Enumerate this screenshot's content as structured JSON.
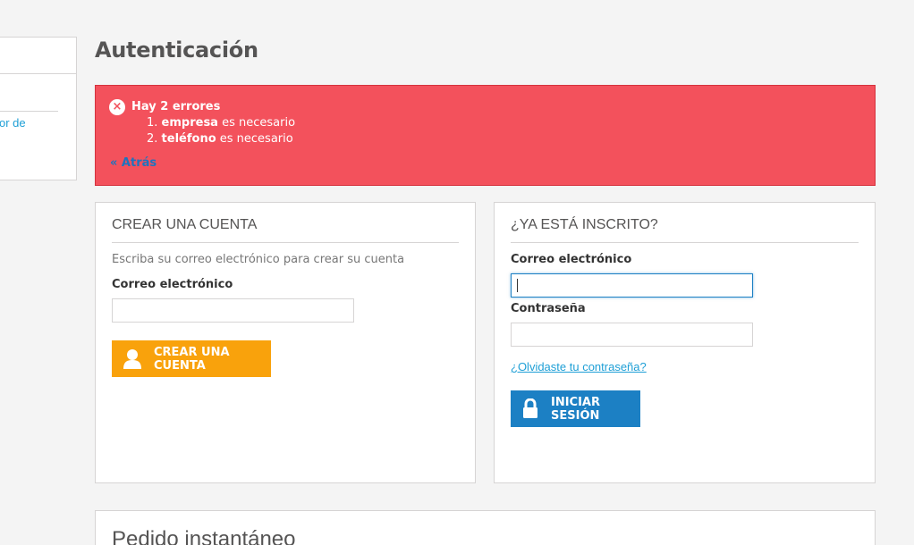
{
  "sidebar": {
    "link_fragment": "or de"
  },
  "page": {
    "title": "Autenticación"
  },
  "alert": {
    "title": "Hay 2 errores",
    "errors": [
      {
        "num": "1.",
        "field": "empresa",
        "msg": "es necesario"
      },
      {
        "num": "2.",
        "field": "teléfono",
        "msg": "es necesario"
      }
    ],
    "back_link": "« Atrás"
  },
  "create_account": {
    "heading": "CREAR UNA CUENTA",
    "hint": "Escriba su correo electrónico para crear su cuenta",
    "email_label": "Correo electrónico",
    "email_value": "",
    "button_label": "CREAR UNA CUENTA",
    "button_icon": "user-icon",
    "button_color": "#f9a20c"
  },
  "login": {
    "heading": "¿YA ESTÁ INSCRITO?",
    "email_label": "Correo electrónico",
    "email_value": "",
    "password_label": "Contraseña",
    "password_value": "",
    "forgot_link": "¿Olvidaste tu contraseña?",
    "button_label": "INICIAR SESIÓN",
    "button_icon": "lock-icon",
    "button_color": "#1c80c4"
  },
  "quick_order": {
    "heading": "Pedido instantáneo"
  },
  "colors": {
    "alert_bg": "#f3515c",
    "link": "#1e9fd6"
  }
}
